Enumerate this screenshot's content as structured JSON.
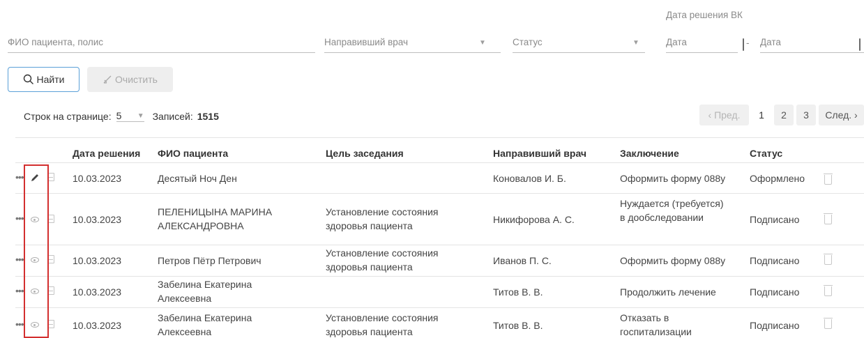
{
  "filters": {
    "patient_placeholder": "ФИО пациента, полис",
    "doctor_placeholder": "Направивший врач",
    "status_placeholder": "Статус",
    "vk_date_label": "Дата решения ВК",
    "date_from_placeholder": "Дата",
    "date_sep": "-",
    "date_to_placeholder": "Дата"
  },
  "buttons": {
    "find_label": "Найти",
    "clear_label": "Очистить"
  },
  "pager": {
    "rows_label": "Строк на странице:",
    "rows_value": "5",
    "records_label": "Записей:",
    "records_value": "1515",
    "prev_label": "‹ Пред.",
    "pages": [
      "1",
      "2",
      "3"
    ],
    "next_label": "След. ›"
  },
  "table": {
    "headers": {
      "date": "Дата решения",
      "patient": "ФИО пациента",
      "goal": "Цель заседания",
      "doctor": "Направивший врач",
      "conclusion": "Заключение",
      "status": "Статус"
    },
    "rows": [
      {
        "date": "10.03.2023",
        "patient": "Десятый Ноч Ден",
        "goal": "",
        "doctor": "Коновалов И. Б.",
        "conclusion": "Оформить форму 088у",
        "status": "Оформлено",
        "action_icon": "pencil-icon"
      },
      {
        "date": "10.03.2023",
        "patient": "ПЕЛЕНИЦЫНА МАРИНА АЛЕКСАНДРОВНА",
        "goal": "Установление состояния здоровья пациента",
        "doctor": "Никифорова А. С.",
        "conclusion": "Нуждается (требуется) в дообследовании",
        "status": "Подписано",
        "action_icon": "eye-icon"
      },
      {
        "date": "10.03.2023",
        "patient": "Петров Пётр Петрович",
        "goal": "Установление состояния здоровья пациента",
        "doctor": "Иванов П. С.",
        "conclusion": "Оформить форму 088у",
        "status": "Подписано",
        "action_icon": "eye-icon"
      },
      {
        "date": "10.03.2023",
        "patient": "Забелина Екатерина Алексеевна",
        "goal": "",
        "doctor": "Титов В. В.",
        "conclusion": "Продолжить лечение",
        "status": "Подписано",
        "action_icon": "eye-icon"
      },
      {
        "date": "10.03.2023",
        "patient": "Забелина Екатерина Алексеевна",
        "goal": "Установление состояния здоровья пациента",
        "doctor": "Титов В. В.",
        "conclusion": "Отказать в госпитализации",
        "status": "Подписано",
        "action_icon": "eye-icon"
      }
    ]
  },
  "colors": {
    "accent": "#5aa0d8",
    "highlight_box": "#d32f2f"
  }
}
